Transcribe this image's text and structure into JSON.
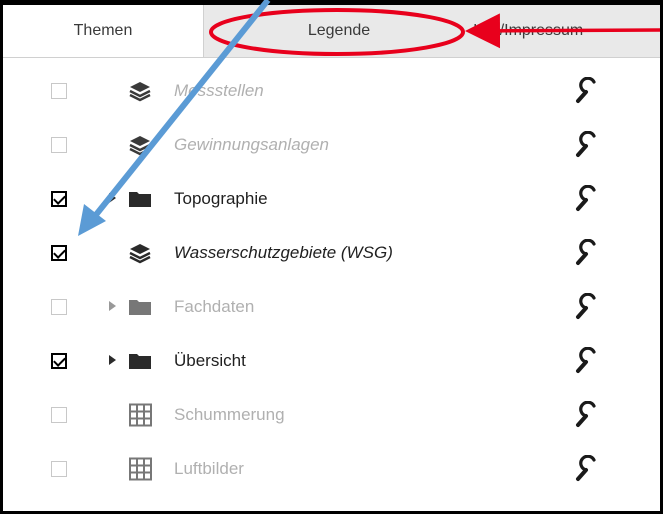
{
  "tabs": [
    {
      "label": "Themen"
    },
    {
      "label": "Legende"
    },
    {
      "label": "Info/Impressum"
    }
  ],
  "layers": [
    {
      "label": "Messstellen",
      "checked": false,
      "enabled": false,
      "italic": true,
      "icon": "layers-icon",
      "expandable": false
    },
    {
      "label": "Gewinnungsanlagen",
      "checked": false,
      "enabled": false,
      "italic": true,
      "icon": "layers-icon",
      "expandable": false
    },
    {
      "label": "Topographie",
      "checked": true,
      "enabled": true,
      "italic": false,
      "icon": "folder-icon",
      "expandable": true
    },
    {
      "label": "Wasserschutzgebiete (WSG)",
      "checked": true,
      "enabled": true,
      "italic": true,
      "icon": "layers-icon",
      "expandable": false
    },
    {
      "label": "Fachdaten",
      "checked": false,
      "enabled": false,
      "italic": false,
      "icon": "folder-icon",
      "expandable": true
    },
    {
      "label": "Übersicht",
      "checked": true,
      "enabled": true,
      "italic": false,
      "icon": "folder-icon",
      "expandable": true
    },
    {
      "label": "Schummerung",
      "checked": false,
      "enabled": false,
      "italic": false,
      "icon": "grid-icon",
      "expandable": false
    },
    {
      "label": "Luftbilder",
      "checked": false,
      "enabled": false,
      "italic": false,
      "icon": "grid-icon",
      "expandable": false
    }
  ],
  "row_action_icon": "wrench-icon",
  "annotations": {
    "highlight_color": "#e8001c",
    "arrow_color": "#5b9bd5",
    "ellipse_target": "tab-legende",
    "blue_arrow_target": "checkbox-wasserschutzgebiete"
  }
}
